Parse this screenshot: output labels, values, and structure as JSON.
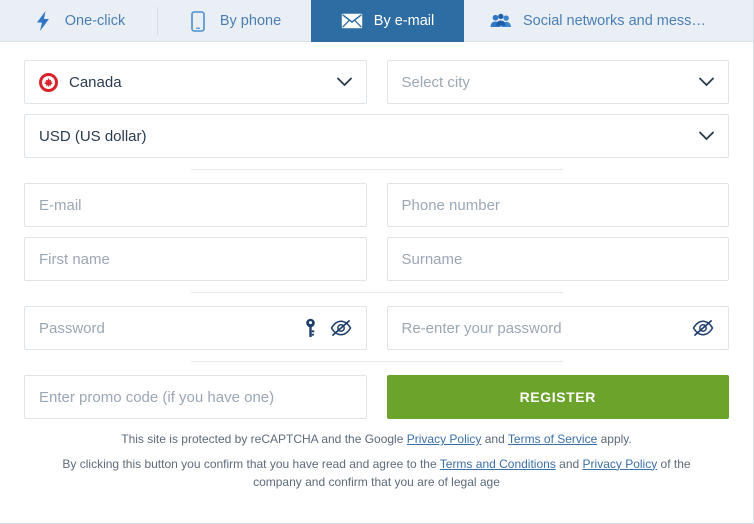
{
  "tabs": [
    {
      "label": "One-click",
      "icon": "bolt-icon",
      "active": false
    },
    {
      "label": "By phone",
      "icon": "phone-icon",
      "active": false
    },
    {
      "label": "By e-mail",
      "icon": "envelope-icon",
      "active": true
    },
    {
      "label": "Social networks and mess…",
      "icon": "people-icon",
      "active": false
    }
  ],
  "form": {
    "country": {
      "value": "Canada",
      "flag": "canada-flag-icon",
      "caret": "chevron-down-icon"
    },
    "city": {
      "placeholder": "Select city",
      "caret": "chevron-down-icon"
    },
    "currency": {
      "value": "USD (US dollar)",
      "caret": "chevron-down-icon"
    },
    "email": {
      "placeholder": "E-mail"
    },
    "phone": {
      "placeholder": "Phone number"
    },
    "first_name": {
      "placeholder": "First name"
    },
    "surname": {
      "placeholder": "Surname"
    },
    "password": {
      "placeholder": "Password",
      "key_icon": "key-icon",
      "eye_icon": "eye-slash-icon"
    },
    "password_repeat": {
      "placeholder": "Re-enter your password",
      "eye_icon": "eye-slash-icon"
    },
    "promo": {
      "placeholder": "Enter promo code (if you have one)"
    },
    "register_label": "REGISTER"
  },
  "legal": {
    "recaptcha_pre": "This site is protected by reCAPTCHA and the Google ",
    "recaptcha_link1": "Privacy Policy",
    "recaptcha_mid": " and ",
    "recaptcha_link2": "Terms of Service",
    "recaptcha_post": " apply.",
    "terms_pre": "By clicking this button you confirm that you have read and agree to the ",
    "terms_link1": "Terms and Conditions",
    "terms_mid": " and ",
    "terms_link2": "Privacy Policy",
    "terms_post": " of the company and confirm that you are of legal age"
  },
  "colors": {
    "tabbar_bg": "#e9eff5",
    "tab_text": "#4a7fb5",
    "tab_active_bg": "#2e6da4",
    "register_green": "#6ba32b",
    "link_blue": "#3b6fa8",
    "placeholder": "#9ba7b4",
    "value_text": "#2a3b4d",
    "border": "#dfe4e9"
  }
}
